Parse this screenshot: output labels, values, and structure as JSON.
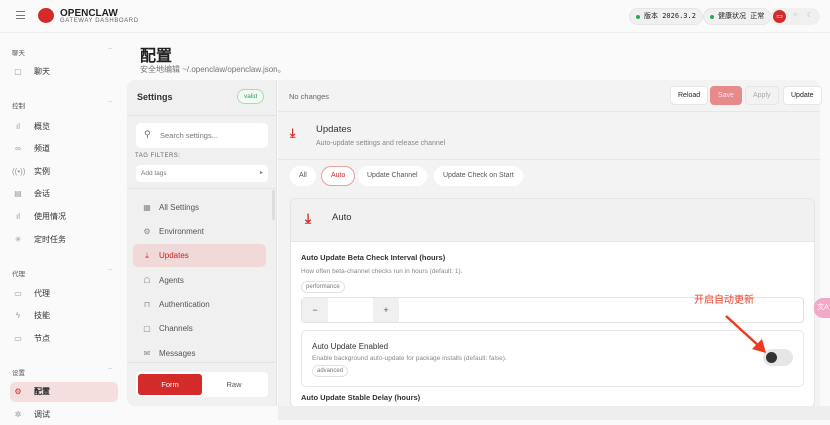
{
  "header": {
    "brand": "OPENCLAW",
    "brand_sub": "GATEWAY DASHBOARD",
    "version": "版本 2026.3.2",
    "health": "健康状况 正常"
  },
  "sidebar": {
    "sections": [
      {
        "label": "聊天"
      },
      {
        "label": "控制"
      },
      {
        "label": "代理"
      },
      {
        "label": "设置"
      }
    ],
    "items": [
      {
        "label": "聊天"
      },
      {
        "label": "概览"
      },
      {
        "label": "频道"
      },
      {
        "label": "实例"
      },
      {
        "label": "会话"
      },
      {
        "label": "使用情况"
      },
      {
        "label": "定时任务"
      },
      {
        "label": "代理"
      },
      {
        "label": "技能"
      },
      {
        "label": "节点"
      },
      {
        "label": "配置"
      },
      {
        "label": "调试"
      }
    ]
  },
  "page": {
    "title": "配置",
    "subtitle": "安全地编辑 ~/.openclaw/openclaw.json。"
  },
  "settings": {
    "title": "Settings",
    "badge": "valid",
    "search_placeholder": "Search settings...",
    "tag_filters_label": "TAG FILTERS:",
    "tags_placeholder": "Add tags",
    "nav": [
      {
        "label": "All Settings"
      },
      {
        "label": "Environment"
      },
      {
        "label": "Updates"
      },
      {
        "label": "Agents"
      },
      {
        "label": "Authentication"
      },
      {
        "label": "Channels"
      },
      {
        "label": "Messages"
      }
    ],
    "mode_form": "Form",
    "mode_raw": "Raw"
  },
  "toolbar": {
    "status": "No changes",
    "reload": "Reload",
    "save": "Save",
    "apply": "Apply",
    "update": "Update"
  },
  "section": {
    "title": "Updates",
    "description": "Auto-update settings and release channel",
    "chips": [
      {
        "label": "All"
      },
      {
        "label": "Auto"
      },
      {
        "label": "Update Channel"
      },
      {
        "label": "Update Check on Start"
      }
    ]
  },
  "card": {
    "title": "Auto",
    "beta": {
      "label": "Auto Update Beta Check Interval (hours)",
      "help": "How often beta-channel checks run in hours (default: 1).",
      "tag": "performance",
      "minus": "−",
      "plus": "+",
      "value": ""
    },
    "enabled": {
      "label": "Auto Update Enabled",
      "help": "Enable background auto-update for package installs (default: false).",
      "tag": "advanced",
      "on": false
    },
    "stable": {
      "label": "Auto Update Stable Delay (hours)"
    }
  },
  "annotation": {
    "text": "开启自动更新"
  }
}
